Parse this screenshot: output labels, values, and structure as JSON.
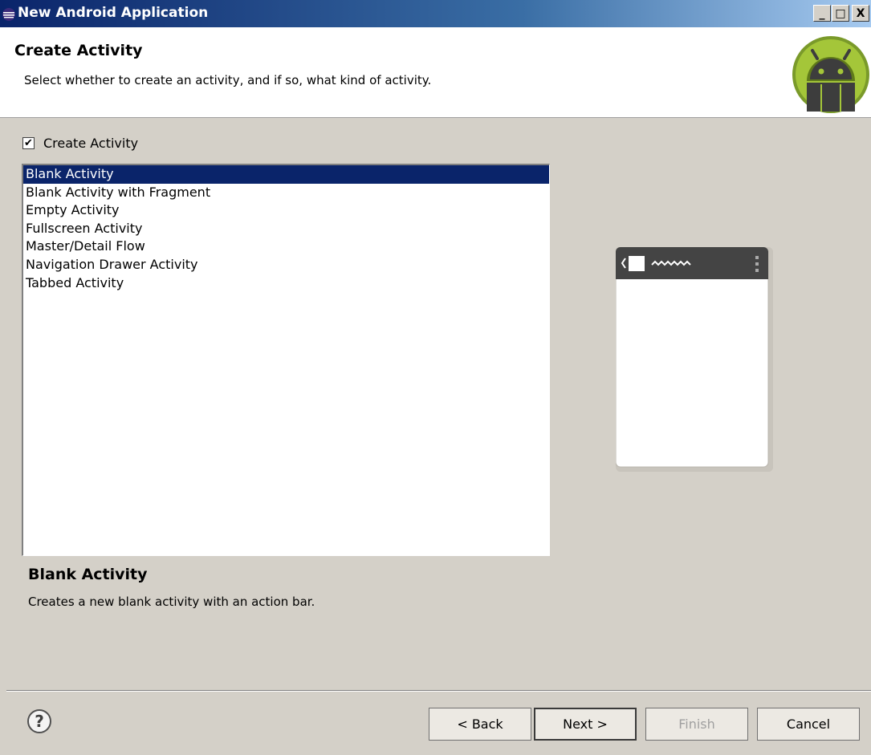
{
  "window": {
    "title": "New Android Application",
    "minimize_label": "_",
    "maximize_label": "□",
    "close_label": "X"
  },
  "header": {
    "title": "Create Activity",
    "description": "Select whether to create an activity, and if so, what kind of activity."
  },
  "create_activity": {
    "label": "Create Activity",
    "checked": true,
    "check_glyph": "✔"
  },
  "activity_list": {
    "items": [
      {
        "label": "Blank Activity",
        "selected": true
      },
      {
        "label": "Blank Activity with Fragment",
        "selected": false
      },
      {
        "label": "Empty Activity",
        "selected": false
      },
      {
        "label": "Fullscreen Activity",
        "selected": false
      },
      {
        "label": "Master/Detail Flow",
        "selected": false
      },
      {
        "label": "Navigation Drawer Activity",
        "selected": false
      },
      {
        "label": "Tabbed Activity",
        "selected": false
      }
    ]
  },
  "selection_detail": {
    "title": "Blank Activity",
    "description": "Creates a new blank activity with an action bar."
  },
  "buttons": {
    "help": "?",
    "back": "< Back",
    "next": "Next >",
    "finish": "Finish",
    "cancel": "Cancel"
  },
  "colors": {
    "selection": "#0a246a",
    "dialog_bg": "#d4d0c8",
    "android_green": "#a4c639"
  }
}
